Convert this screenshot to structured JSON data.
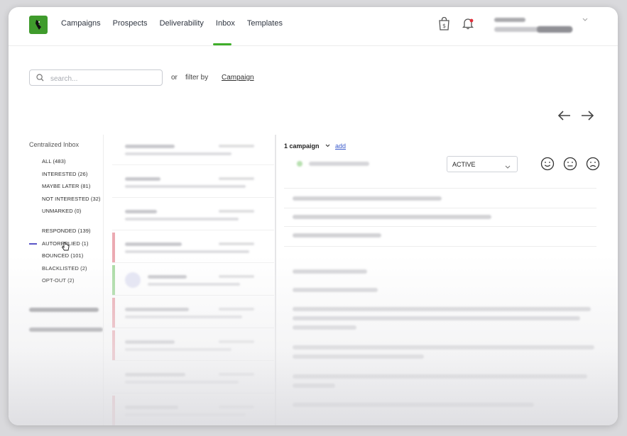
{
  "nav": {
    "items": [
      "Campaigns",
      "Prospects",
      "Deliverability",
      "Inbox",
      "Templates"
    ],
    "active": "Inbox"
  },
  "search": {
    "placeholder": "search...",
    "or_label": "or",
    "filter_label": "filter by",
    "filter_value": "Campaign"
  },
  "sidebar": {
    "title": "Centralized Inbox",
    "items": [
      "ALL (483)",
      "INTERESTED (26)",
      "MAYBE LATER (81)",
      "NOT INTERESTED (32)",
      "UNMARKED (0)",
      "RESPONDED (139)",
      "AUTOREPLIED (1)",
      "BOUNCED (101)",
      "BLACKLISTED (2)",
      "OPT-OUT (2)"
    ],
    "selected": "AUTOREPLIED (1)"
  },
  "detail": {
    "campaign_count": "1 campaign",
    "add_label": "add",
    "status_value": "ACTIVE"
  },
  "icons": {
    "logo": "bird-logo-icon",
    "shop": "shopping-bag-dollar-icon",
    "notifications": "bell-icon",
    "reply": "reply-arrow-icon",
    "forward": "forward-arrow-icon",
    "happy": "smiley-happy-icon",
    "neutral": "smiley-neutral-icon",
    "sad": "smiley-sad-icon",
    "search": "search-icon"
  },
  "colors": {
    "brand_green": "#3f9b2c",
    "nav_underline": "#3fae2a",
    "link_blue": "#3b5bcc",
    "status_red": "#e35d6a",
    "status_green": "#7ccf73",
    "autoreply_marker": "#5a55c8"
  }
}
